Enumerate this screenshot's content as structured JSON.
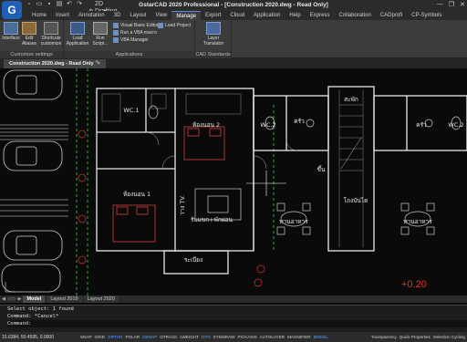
{
  "window": {
    "title": "GstarCAD 2020 Professional - [Construction 2020.dwg - Read Only]",
    "workspace": "2D Drafting",
    "logo": "G"
  },
  "ribbon_tabs": [
    "Home",
    "Insert",
    "Annotation",
    "3D",
    "Layout",
    "View",
    "Manage",
    "Export",
    "Cloud",
    "Application",
    "Help",
    "Express",
    "Collaboration",
    "CADprofi",
    "CP-Symbols"
  ],
  "active_tab": "Manage",
  "ribbon": {
    "customize": {
      "title": "Customize settings",
      "interface": "Interface",
      "edit_aliases": "Edit Aliases",
      "shortcuts": "Shortcuts customize"
    },
    "applications": {
      "title": "Applications",
      "load_app": "Load Application",
      "run_script": "Run Script...",
      "vba_editor": "Visual Basic Editor",
      "run_vba": "Run a VBA macro",
      "vba_manager": "VBA Manager",
      "load_project": "Load Project"
    },
    "cad_standards": {
      "title": "CAD Standards",
      "layer_translator": "Layer Translator"
    }
  },
  "document_tab": "Construction 2020.dwg - Read Only",
  "drawing": {
    "rooms": {
      "wc1": "WC.1",
      "bed2": "ห้องนอน 2",
      "wc2a": "WC.2",
      "kitchen": "ครัว",
      "stair": "สะพัก",
      "wc2b": "WC.2",
      "kitchen2": "ครัว",
      "up": "ขึ้น",
      "bed1": "ห้องนอน 1",
      "tv": "วาง TV.",
      "living": "รับแขก+พักผ่อน",
      "dining1": "ทานอาหาร",
      "garage": "โถงบันได",
      "dining2": "ทานอาหาร",
      "terrace": "ระเบียง"
    },
    "dimension": "+0.20"
  },
  "layout_tabs": [
    "Model",
    "Layout 2019",
    "Layout 2020"
  ],
  "command": {
    "line1": "Select object:  1 found",
    "line2": "Command: *Cancel*",
    "prompt": "Command:"
  },
  "status": {
    "coords": "15.6384, 50.4595, 0.0000",
    "buttons": [
      "SNAP",
      "GRID",
      "ORTHO",
      "POLAR",
      "OSNAP",
      "OTRACK",
      "LWEIGHT",
      "DYN",
      "SYMDRAW",
      "PICKAXIS",
      "AUTOLAYER",
      "MAGNIFIER",
      "MODEL"
    ],
    "right": [
      "Transparency",
      "Quick Properties",
      "Selection Cycling"
    ]
  }
}
